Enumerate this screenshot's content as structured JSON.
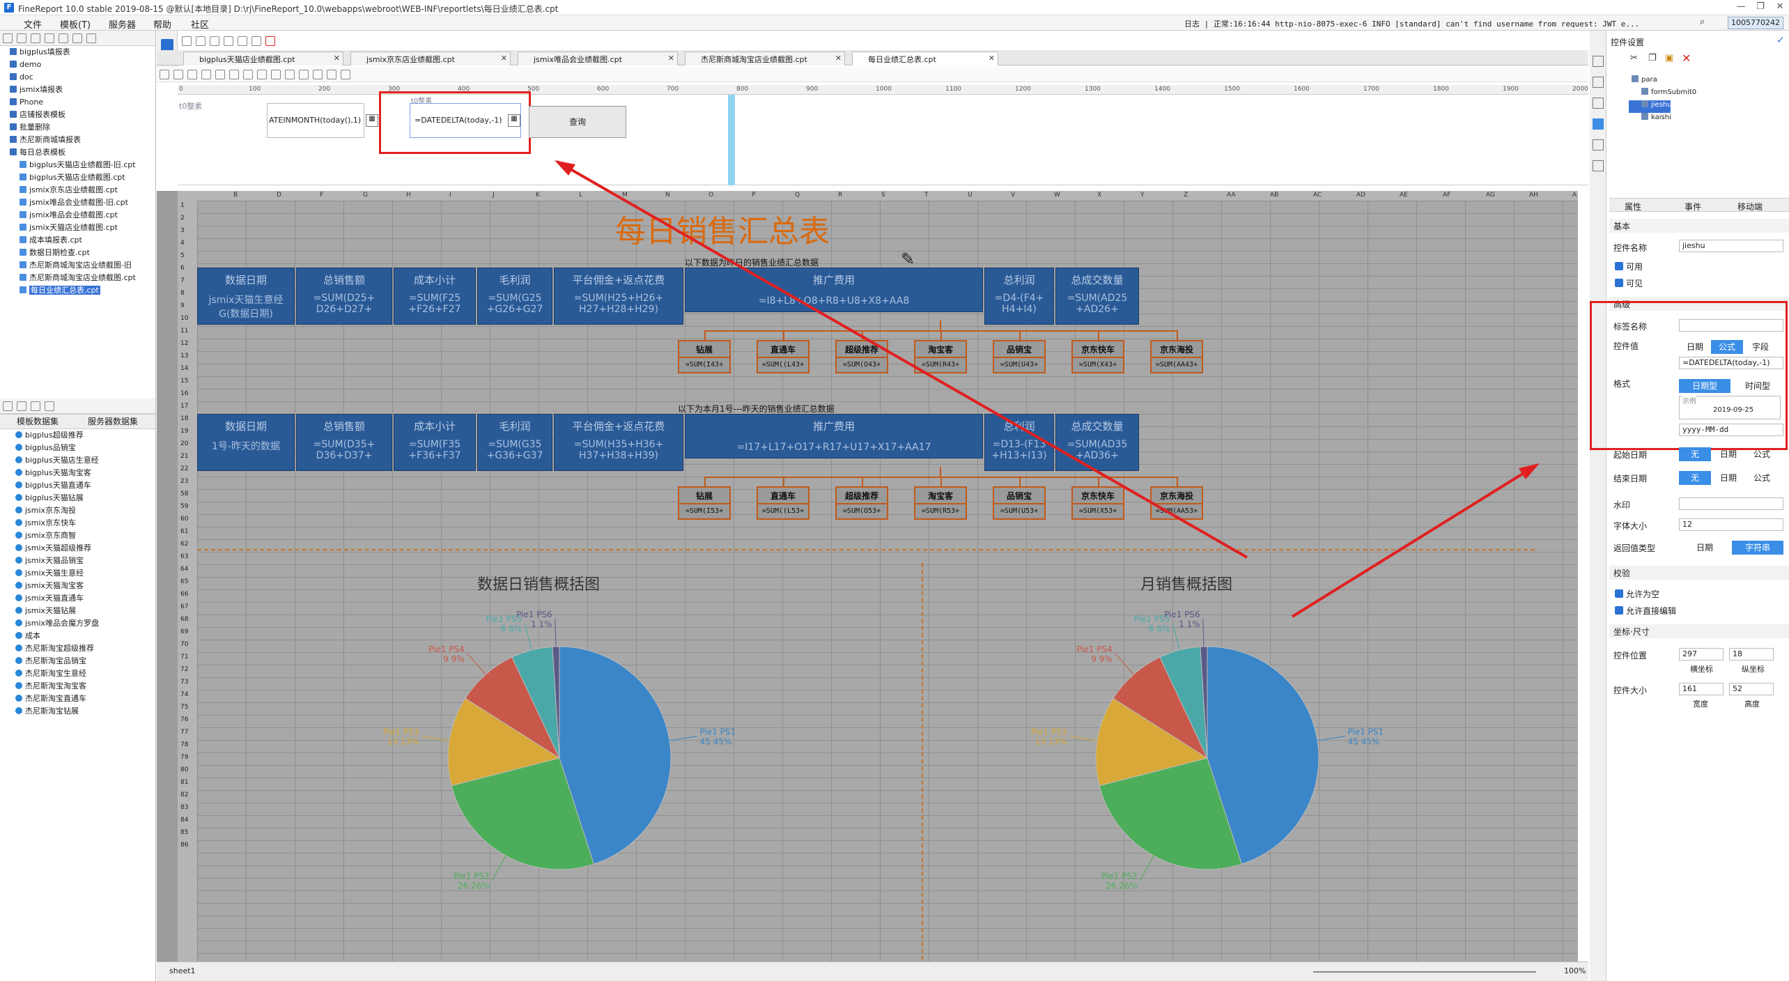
{
  "window": {
    "title": "FineReport 10.0 stable 2019-08-15 @默认[本地目录]    D:\\rj\\FineReport_10.0\\webapps\\webroot\\WEB-INF\\reportlets\\每日业绩汇总表.cpt"
  },
  "menu": [
    "文件",
    "模板(T)",
    "服务器",
    "帮助",
    "社区"
  ],
  "log": {
    "text": "日志 | 正常:16:16:44 http-nio-8075-exec-6 INFO [standard] can't find username from request: JWT e...",
    "user": "1005770242"
  },
  "left": {
    "files": [
      {
        "label": "bigplus填报表",
        "type": "folder"
      },
      {
        "label": "demo",
        "type": "folder"
      },
      {
        "label": "doc",
        "type": "folder"
      },
      {
        "label": "jsmix填报表",
        "type": "folder"
      },
      {
        "label": "Phone",
        "type": "folder"
      },
      {
        "label": "店铺报表模板",
        "type": "folder"
      },
      {
        "label": "批量删除",
        "type": "folder"
      },
      {
        "label": "杰尼斯商城填报表",
        "type": "folder"
      },
      {
        "label": "每日总表模板",
        "type": "folder"
      },
      {
        "label": "bigplus天猫店业绩截图-旧.cpt",
        "type": "file"
      },
      {
        "label": "bigplus天猫店业绩截图.cpt",
        "type": "file"
      },
      {
        "label": "jsmix京东店业绩截图.cpt",
        "type": "file"
      },
      {
        "label": "jsmix唯品会业绩截图-旧.cpt",
        "type": "file"
      },
      {
        "label": "jsmix唯品会业绩截图.cpt",
        "type": "file"
      },
      {
        "label": "jsmix天猫店业绩截图.cpt",
        "type": "file"
      },
      {
        "label": "成本填报表.cpt",
        "type": "file"
      },
      {
        "label": "数据日期检查.cpt",
        "type": "file"
      },
      {
        "label": "杰尼斯商城淘宝店业绩截图-旧",
        "type": "file"
      },
      {
        "label": "杰尼斯商城淘宝店业绩截图.cpt",
        "type": "file"
      },
      {
        "label": "每日业绩汇总表.cpt",
        "type": "file",
        "selected": true
      }
    ],
    "dstabs": [
      "模板数据集",
      "服务器数据集"
    ],
    "datasets": [
      "bigplus超级推荐",
      "bigplus品销宝",
      "bigplus天猫店生意经",
      "bigplus天猫淘宝客",
      "bigplus天猫直通车",
      "bigplus天猫钻展",
      "jsmix京东淘投",
      "jsmix京东快车",
      "jsmix京东商智",
      "jsmix天猫超级推荐",
      "jsmix天猫品销宝",
      "jsmix天猫生意经",
      "jsmix天猫淘宝客",
      "jsmix天猫直通车",
      "jsmix天猫钻展",
      "jsmix唯品会魔方罗盘",
      "成本",
      "杰尼斯淘宝超级推荐",
      "杰尼斯淘宝品销宝",
      "杰尼斯淘宝生意经",
      "杰尼斯淘宝淘宝客",
      "杰尼斯淘宝直通车",
      "杰尼斯淘宝钻展"
    ]
  },
  "filetabs": [
    {
      "label": "bigplus天猫店业绩截图.cpt"
    },
    {
      "label": "jsmix京东店业绩截图.cpt"
    },
    {
      "label": "jsmix唯品会业绩截图.cpt"
    },
    {
      "label": "杰尼斯商城淘宝店业绩截图.cpt"
    },
    {
      "label": "每日业绩汇总表.cpt",
      "active": true
    }
  ],
  "ruler": [
    "0",
    "100",
    "200",
    "300",
    "400",
    "500",
    "600",
    "700",
    "800",
    "900",
    "1000",
    "1100",
    "1200",
    "1300",
    "1400",
    "1500",
    "1600",
    "1700",
    "1800",
    "1900",
    "2000"
  ],
  "param": {
    "label1": "t0整素",
    "field1": "ATEINMONTH(today(),1)",
    "label2": "t0整素",
    "field2": "=DATEDELTA(today,-1)",
    "query": "查询"
  },
  "sheet": {
    "cols": [
      "B",
      "D",
      "F",
      "G",
      "H",
      "I",
      "J",
      "K",
      "L",
      "M",
      "N",
      "O",
      "P",
      "Q",
      "R",
      "S",
      "T",
      "U",
      "V",
      "W",
      "X",
      "Y",
      "Z",
      "AA",
      "AB",
      "AC",
      "AD",
      "AE",
      "AF",
      "AG",
      "AH",
      "A"
    ],
    "rows": [
      "1",
      "2",
      "3",
      "4",
      "5",
      "6",
      "7",
      "8",
      "9",
      "10",
      "11",
      "12",
      "13",
      "14",
      "15",
      "16",
      "17",
      "18",
      "19",
      "20",
      "21",
      "22",
      "23",
      "58",
      "59",
      "60",
      "61",
      "62",
      "63",
      "64",
      "65",
      "66",
      "67",
      "68",
      "69",
      "70",
      "71",
      "72",
      "73",
      "74",
      "75",
      "76",
      "77",
      "78",
      "79",
      "80",
      "81",
      "82",
      "83",
      "84",
      "85",
      "86"
    ],
    "title": "每日销售汇总表",
    "sub1": "以下数据为昨日的销售业绩汇总数据",
    "sub2": "以下为本月1号---昨天的销售业绩汇总数据",
    "hdr": [
      "数据日期",
      "总销售额",
      "成本小计",
      "毛利润",
      "平台佣金+返点花费",
      "推广费用",
      "总利润",
      "总成交数量"
    ],
    "row1": [
      "jsmix天猫生意经 G(数据日期)",
      "=SUM(D25+ D26+D27+",
      "=SUM(F25 +F26+F27",
      "=SUM(G25 +G26+G27",
      "=SUM(H25+H26+ H27+H28+H29)",
      "=I8+L8+O8+R8+U8+X8+AA8",
      "=D4-(F4+ H4+I4)",
      "=SUM(AD25 +AD26+"
    ],
    "row2": [
      "1号-昨天的数据",
      "=SUM(D35+ D36+D37+",
      "=SUM(F35 +F36+F37",
      "=SUM(G35 +G36+G37",
      "=SUM(H35+H36+ H37+H38+H39)",
      "=I17+L17+O17+R17+U17+X17+AA17",
      "=D13-(F13 +H13+I13)",
      "=SUM(AD35 +AD36+"
    ],
    "subs1": [
      [
        "钻展",
        "=SUM(I43+"
      ],
      [
        "直通车",
        "=SUM((L43+"
      ],
      [
        "超级推荐",
        "=SUM(O43+"
      ],
      [
        "淘宝客",
        "=SUM(R43+"
      ],
      [
        "品销宝",
        "=SUM(U43+"
      ],
      [
        "京东快车",
        "=SUM(X43+"
      ],
      [
        "京东海投",
        "=SUM(AA43+"
      ]
    ],
    "subs2": [
      [
        "钻展",
        "=SUM(I53+"
      ],
      [
        "直通车",
        "=SUM((L53+"
      ],
      [
        "超级推荐",
        "=SUM(O53+"
      ],
      [
        "淘宝客",
        "=SUM(R53+"
      ],
      [
        "品销宝",
        "=SUM(U53+"
      ],
      [
        "京东快车",
        "=SUM(X53+"
      ],
      [
        "京东海投",
        "=SUM(AA53+"
      ]
    ],
    "sheetname": "sheet1",
    "zoom": "100%"
  },
  "chart_data": [
    {
      "type": "pie",
      "title": "数据日销售概括图",
      "slices": [
        {
          "name": "Pie1 PS1",
          "value": 45,
          "pct": "45%",
          "color": "#3a86c8"
        },
        {
          "name": "Pie1 PS2",
          "value": 26,
          "pct": "26%",
          "color": "#4cae5a"
        },
        {
          "name": "Pie1 PS3",
          "value": 13,
          "pct": "13%",
          "color": "#d8a838"
        },
        {
          "name": "Pie1 PS4",
          "value": 9,
          "pct": "9%",
          "color": "#c8584a"
        },
        {
          "name": "Pie1 PS5",
          "value": 6,
          "pct": "6%",
          "color": "#4aa8a8"
        },
        {
          "name": "Pie1 PS6",
          "value": 1,
          "pct": "1%",
          "color": "#5a5a88"
        }
      ]
    },
    {
      "type": "pie",
      "title": "月销售概括图",
      "slices": [
        {
          "name": "Pie1 PS1",
          "value": 45,
          "pct": "45%",
          "color": "#3a86c8"
        },
        {
          "name": "Pie1 PS2",
          "value": 26,
          "pct": "26%",
          "color": "#4cae5a"
        },
        {
          "name": "Pie1 PS3",
          "value": 13,
          "pct": "13%",
          "color": "#d8a838"
        },
        {
          "name": "Pie1 PS4",
          "value": 9,
          "pct": "9%",
          "color": "#c8584a"
        },
        {
          "name": "Pie1 PS5",
          "value": 6,
          "pct": "6%",
          "color": "#4aa8a8"
        },
        {
          "name": "Pie1 PS6",
          "value": 1,
          "pct": "1%",
          "color": "#5a5a88"
        }
      ]
    }
  ],
  "right": {
    "header": "控件设置",
    "tree": [
      "para",
      "formSubmit0",
      "jieshu",
      "kaishi"
    ],
    "tabs": [
      "属性",
      "事件",
      "移动端"
    ],
    "basic": "基本",
    "name_label": "控件名称",
    "name_value": "jieshu",
    "enable": "可用",
    "visible": "可见",
    "advanced": "高级",
    "tag_label": "标签名称",
    "value_label": "控件值",
    "value_modes": [
      "日期",
      "公式",
      "字段"
    ],
    "formula": "=DATEDELTA(today,-1)",
    "format_label": "格式",
    "format_modes": [
      "日期型",
      "时间型"
    ],
    "example": "示例",
    "example_value": "2019-09-25",
    "pattern": "yyyy-MM-dd",
    "start_label": "起始日期",
    "end_label": "结束日期",
    "mode3": [
      "无",
      "日期",
      "公式"
    ],
    "watermark": "水印",
    "fontsize_label": "字体大小",
    "fontsize": "12",
    "return_label": "返回值类型",
    "return_modes": [
      "日期",
      "字符串"
    ],
    "validate": "校验",
    "allow_empty": "允许为空",
    "allow_edit": "允许直接编辑",
    "coords": "坐标·尺寸",
    "pos_label": "控件位置",
    "pos_x": "297",
    "pos_y": "18",
    "pos_xl": "横坐标",
    "pos_yl": "纵坐标",
    "size_label": "控件大小",
    "size_w": "161",
    "size_h": "52",
    "size_wl": "宽度",
    "size_hl": "高度"
  },
  "colors": {
    "accent": "#3a8ee6",
    "highlight": "#e02020",
    "header": "#2a5a96",
    "title": "#d96a10"
  }
}
